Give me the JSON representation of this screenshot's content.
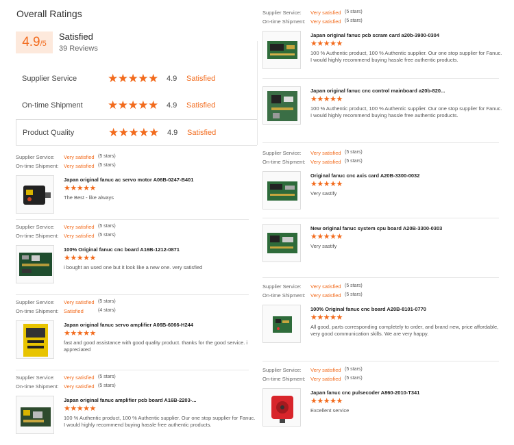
{
  "overall": {
    "title": "Overall Ratings",
    "score": "4.9",
    "score_max": "/5",
    "label": "Satisfied",
    "reviews": "39 Reviews"
  },
  "metrics": [
    {
      "label": "Supplier Service",
      "stars": "★★★★★",
      "score": "4.9",
      "text": "Satisfied"
    },
    {
      "label": "On-time Shipment",
      "stars": "★★★★★",
      "score": "4.9",
      "text": "Satisfied"
    },
    {
      "label": "Product Quality",
      "stars": "★★★★★",
      "score": "4.9",
      "text": "Satisfied"
    }
  ],
  "labels": {
    "supplier_service": "Supplier Service:",
    "on_time_shipment": "On-time Shipment:"
  },
  "reviews": [
    {
      "supplier": "Very satisfied",
      "supplier_stars": "(5 stars)",
      "shipment": "Very satisfied",
      "shipment_stars": "(5 stars)",
      "product": "Japan original fanuc ac servo motor A06B-0247-B401",
      "rating": "★★★★★",
      "comment": "The Best - like always",
      "thumb": "motor"
    },
    {
      "supplier": "Very satisfied",
      "supplier_stars": "(5 stars)",
      "shipment": "Very satisfied",
      "shipment_stars": "(5 stars)",
      "product": "100% Original fanuc cnc board A16B-1212-0871",
      "rating": "★★★★★",
      "comment": "i bought an used one but it look like a new one. very satisfied",
      "thumb": "board"
    },
    {
      "supplier": "Very satisfied",
      "supplier_stars": "(5 stars)",
      "shipment": "Satisfied",
      "shipment_stars": "(4 stars)",
      "product": "Japan original fanuc servo amplifier A06B-6066-H244",
      "rating": "★★★★★",
      "comment": "fast and good assistance with good quality product. thanks for the good service. i appreciated",
      "thumb": "amplifier"
    },
    {
      "supplier": "Very satisfied",
      "supplier_stars": "(5 stars)",
      "shipment": "Very satisfied",
      "shipment_stars": "(5 stars)",
      "product": "Japan original fanuc amplifier pcb board A16B-2203-...",
      "rating": "★★★★★",
      "comment": "100 % Authentic product, 100 % Authentic supplier. Our one stop supplier for Fanuc. I would highly recommend buying hassle free authentic products.",
      "thumb": "pcb"
    },
    {
      "supplier": "Very satisfied",
      "supplier_stars": "(5 stars)",
      "shipment": "Very satisfied",
      "shipment_stars": "(5 stars)",
      "product": "Japan original fanuc pcb scram card a20b-3900-0304",
      "rating": "★★★★★",
      "comment": "100 % Authentic product, 100 % Authentic supplier. Our one stop supplier for Fanuc. I would highly recommend buying hassle free authentic products.",
      "thumb": "card"
    },
    {
      "supplier": null,
      "supplier_stars": null,
      "shipment": null,
      "shipment_stars": null,
      "product": "Japan original fanuc cnc control mainboard a20b-820...",
      "rating": "★★★★★",
      "comment": "100 % Authentic product, 100 % Authentic supplier. Our one stop supplier for Fanuc. I would highly recommend buying hassle free authentic products.",
      "thumb": "mainboard"
    },
    {
      "supplier": "Very satisfied",
      "supplier_stars": "(5 stars)",
      "shipment": "Very satisfied",
      "shipment_stars": "(5 stars)",
      "product": "Original fanuc cnc axis card A20B-3300-0032",
      "rating": "★★★★★",
      "comment": "Very sastify",
      "thumb": "card"
    },
    {
      "supplier": null,
      "supplier_stars": null,
      "shipment": null,
      "shipment_stars": null,
      "product": "New original fanuc system cpu board A20B-3300-0303",
      "rating": "★★★★★",
      "comment": "Very sastify",
      "thumb": "card"
    },
    {
      "supplier": "Very satisfied",
      "supplier_stars": "(5 stars)",
      "shipment": "Very satisfied",
      "shipment_stars": "(5 stars)",
      "product": "100% Original fanuc cnc board A20B-8101-0770",
      "rating": "★★★★★",
      "comment": "All good, parts corresponding completely to order, and brand new, price affordable, very good communication skills. We are very happy.",
      "thumb": "small"
    },
    {
      "supplier": "Very satisfied",
      "supplier_stars": "(5 stars)",
      "shipment": "Very satisfied",
      "shipment_stars": "(5 stars)",
      "product": "Japan fanuc cnc pulsecoder A860-2010-T341",
      "rating": "★★★★★",
      "comment": "Excellent service",
      "thumb": "encoder"
    }
  ]
}
